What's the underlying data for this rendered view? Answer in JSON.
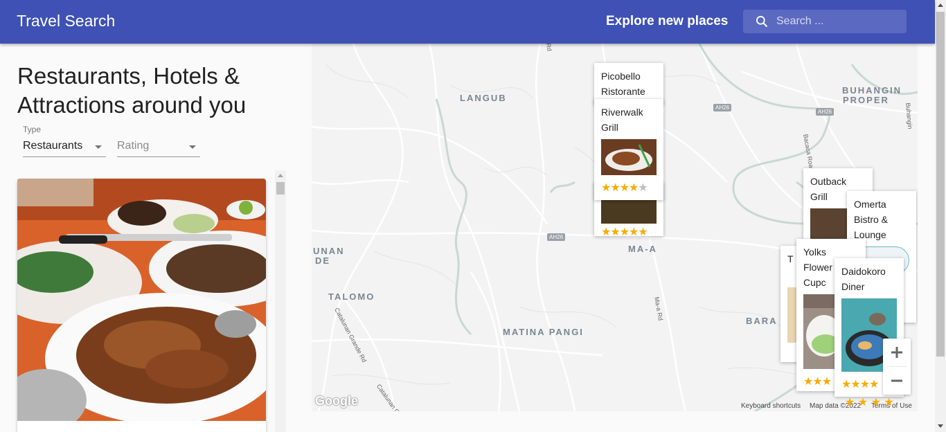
{
  "app": {
    "title": "Travel Search",
    "tagline": "Explore new places"
  },
  "search": {
    "placeholder": "Search ...",
    "icon": "search-icon"
  },
  "sidebar": {
    "heading": "Restaurants, Hotels & Attractions around you",
    "type_field": {
      "label": "Type",
      "value": "Restaurants"
    },
    "rating_field": {
      "label": "",
      "placeholder": "Rating"
    }
  },
  "map": {
    "labels": {
      "langub": "LANGUB",
      "buhangin": "BUHANGIN",
      "proper": "PROPER",
      "maa": "MA-A",
      "talomo": "TALOMO",
      "matina": "MATINA PANGI",
      "bara": "BARA",
      "unan": "UNAN",
      "de": "DE"
    },
    "roads": {
      "ah26": "AH26",
      "rd": "Rd",
      "baroad": "Bacaca Road",
      "buh": "Buhangin",
      "maard": "Ma-a Rd",
      "catalunan": "Catalunan Grande Rd"
    },
    "places": [
      {
        "name": "Picobello Ristorante"
      },
      {
        "name": "Riverwalk Grill",
        "rating": 4
      },
      {
        "name": "Outback Grill"
      },
      {
        "name": "Omerta Bistro & Lounge"
      },
      {
        "name": "T"
      },
      {
        "name": "Yolks Flower + Cupc"
      },
      {
        "name": "Daidokoro Diner"
      }
    ],
    "colors": {
      "water": "#c8d8d3",
      "roads": "#ffffff",
      "land": "#f3f3f3",
      "star": "#f9ab00"
    },
    "zoom_in": "+",
    "zoom_out": "−",
    "google_logo": "Google",
    "attribution": {
      "keyboard": "Keyboard shortcuts",
      "mapdata": "Map data ©2022",
      "terms": "Terms of Use"
    }
  },
  "icons": {
    "arrow": "chevron-down-icon"
  }
}
